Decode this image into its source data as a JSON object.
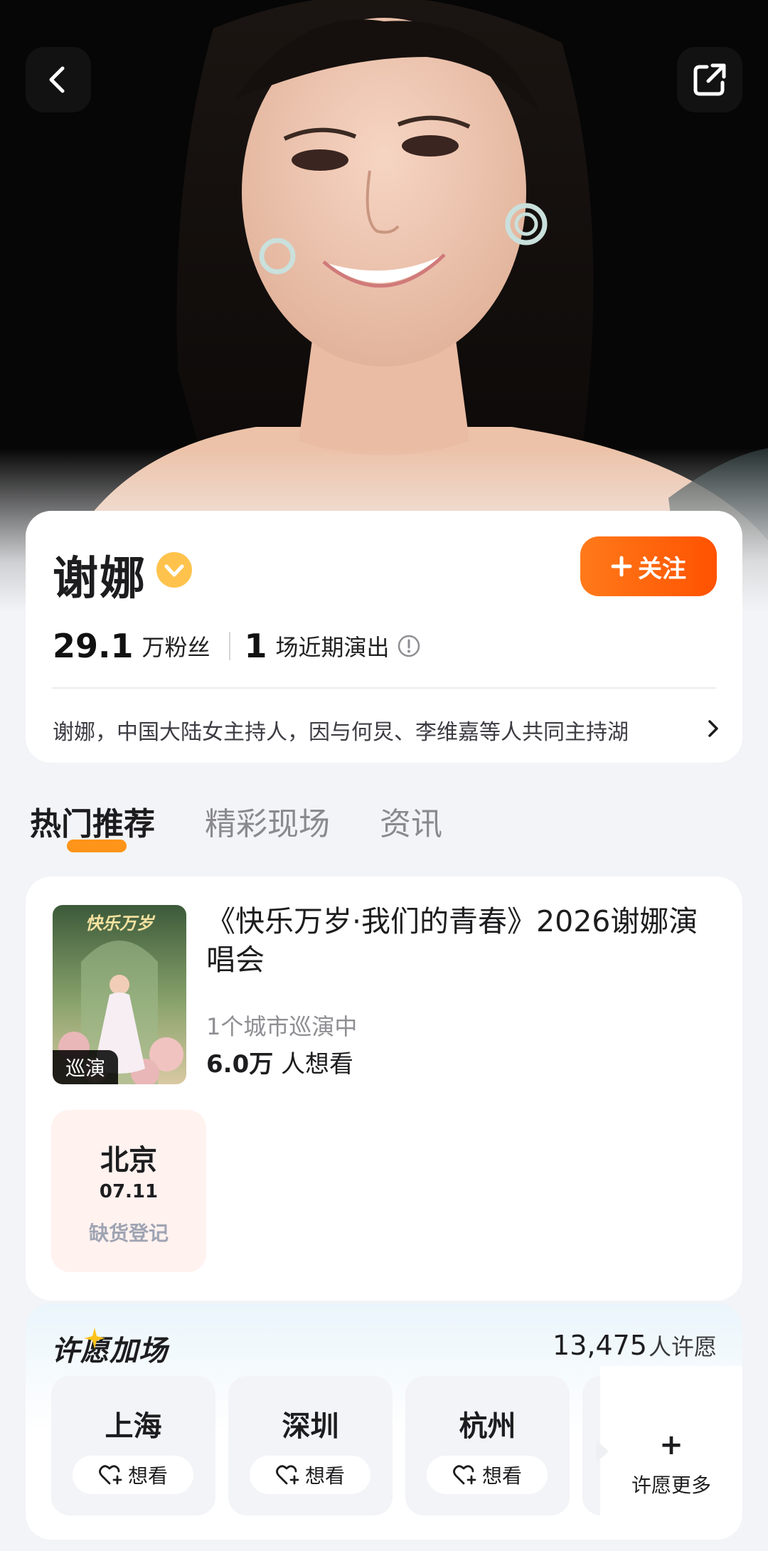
{
  "header": {
    "back_icon": "chevron-left-icon",
    "share_icon": "share-external-icon"
  },
  "artist": {
    "name": "谢娜",
    "verified_icon": "verified-badge-icon",
    "follow_label": "关注",
    "followers_num": "29.1",
    "followers_label": "万粉丝",
    "shows_num": "1",
    "shows_label": "场近期演出",
    "bio": "谢娜，中国大陆女主持人，因与何炅、李维嘉等人共同主持湖"
  },
  "tabs": [
    {
      "label": "热门推荐",
      "active": true
    },
    {
      "label": "精彩现场",
      "active": false
    },
    {
      "label": "资讯",
      "active": false
    }
  ],
  "show": {
    "poster_tag": "巡演",
    "poster_title": "快乐万岁",
    "title": "《快乐万岁·我们的青春》2026谢娜演唱会",
    "cities_text": "1个城市巡演中",
    "want_num": "6.0万",
    "want_label": "人想看",
    "session": {
      "city": "北京",
      "date": "07.11",
      "status": "缺货登记"
    }
  },
  "wish": {
    "title": "许愿加场",
    "count": "13,475",
    "count_label": "人许愿",
    "cities": [
      {
        "name": "上海",
        "button": "想看"
      },
      {
        "name": "深圳",
        "button": "想看"
      },
      {
        "name": "杭州",
        "button": "想看"
      }
    ],
    "more_label": "许愿更多",
    "more_symbol": "+"
  },
  "colors": {
    "accent": "#ff6a00",
    "verified": "#ffc34d",
    "session_bg": "#fff2ef"
  }
}
